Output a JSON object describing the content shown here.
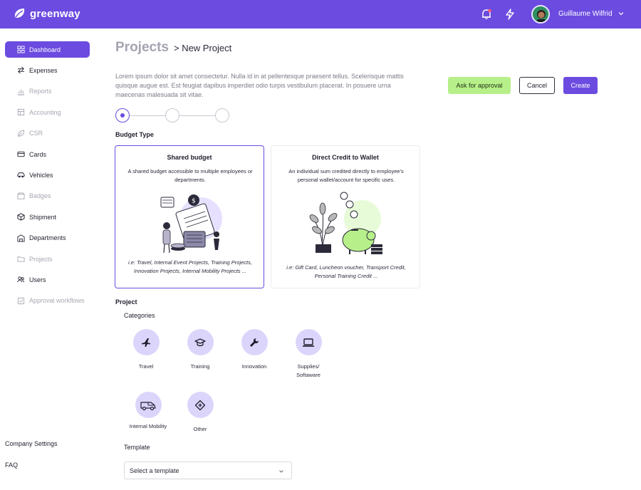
{
  "brand": {
    "name": "greenway"
  },
  "user": {
    "name": "Guillaume Wilfrid"
  },
  "sidebar": {
    "items": [
      {
        "label": "Dashboard",
        "icon": "grid-icon",
        "state": "active"
      },
      {
        "label": "Expenses",
        "icon": "arrows-icon",
        "state": "normal"
      },
      {
        "label": "Reports",
        "icon": "chart-icon",
        "state": "disabled"
      },
      {
        "label": "Accounting",
        "icon": "ledger-icon",
        "state": "disabled"
      },
      {
        "label": "CSR",
        "icon": "leaf-icon",
        "state": "disabled"
      },
      {
        "label": "Cards",
        "icon": "card-icon",
        "state": "normal"
      },
      {
        "label": "Vehicles",
        "icon": "car-icon",
        "state": "normal"
      },
      {
        "label": "Badges",
        "icon": "badge-icon",
        "state": "disabled"
      },
      {
        "label": "Shipment",
        "icon": "box-icon",
        "state": "normal"
      },
      {
        "label": "Departments",
        "icon": "building-icon",
        "state": "normal"
      },
      {
        "label": "Projects",
        "icon": "folder-icon",
        "state": "disabled"
      },
      {
        "label": "Users",
        "icon": "users-icon",
        "state": "normal"
      },
      {
        "label": "Approval workflows",
        "icon": "check-icon",
        "state": "disabled"
      }
    ],
    "footer": {
      "company_settings": "Company Settings",
      "faq": "FAQ"
    }
  },
  "page": {
    "title": "Projects",
    "breadcrumb_current": "> New Project",
    "description": "Lorem ipsum dolor sit amet consectetur. Nulla id in at pellentesque praesent tellus. Scelerisque mattis quisque augue est. Est feugiat dapibus imperdiet odio turpis vestibulum placerat. In posuere urna maecenas malesuada sit vitae."
  },
  "actions": {
    "ask_approval": "Ask for approval",
    "cancel": "Cancel",
    "create": "Create"
  },
  "stepper": {
    "total": 3,
    "current": 1
  },
  "budget": {
    "title": "Budget Type",
    "cards": [
      {
        "title": "Shared budget",
        "description": "A shared budget accessible to multiple employees or departments.",
        "examples": "i.e: Travel, Internal Event Projects, Training Projects, Innovation Projects, Internal Mobility Projects ...",
        "selected": true
      },
      {
        "title": "Direct Credit to Wallet",
        "description": "An individual sum credited directly to employee's personal wallet/account for specific uses.",
        "examples": "i.e: Gift Card, Luncheon voucher, Transport Credit, Personal Training Credit ...",
        "selected": false
      }
    ]
  },
  "project": {
    "title": "Project",
    "categories_title": "Categories",
    "categories": [
      {
        "label": "Travel",
        "icon": "plane-icon"
      },
      {
        "label": "Training",
        "icon": "graduation-cap-icon"
      },
      {
        "label": "Innovation",
        "icon": "wrench-icon"
      },
      {
        "label": "Supplies/\nSoftaware",
        "icon": "laptop-icon"
      },
      {
        "label": "Internal Mobility",
        "icon": "van-icon"
      },
      {
        "label": "Other",
        "icon": "diamond-plus-icon"
      }
    ],
    "template_title": "Template",
    "template_placeholder": "Select a template"
  },
  "colors": {
    "primary": "#6b4be0",
    "approval": "#b7f08a",
    "category_bg": "#dcd5fb"
  }
}
